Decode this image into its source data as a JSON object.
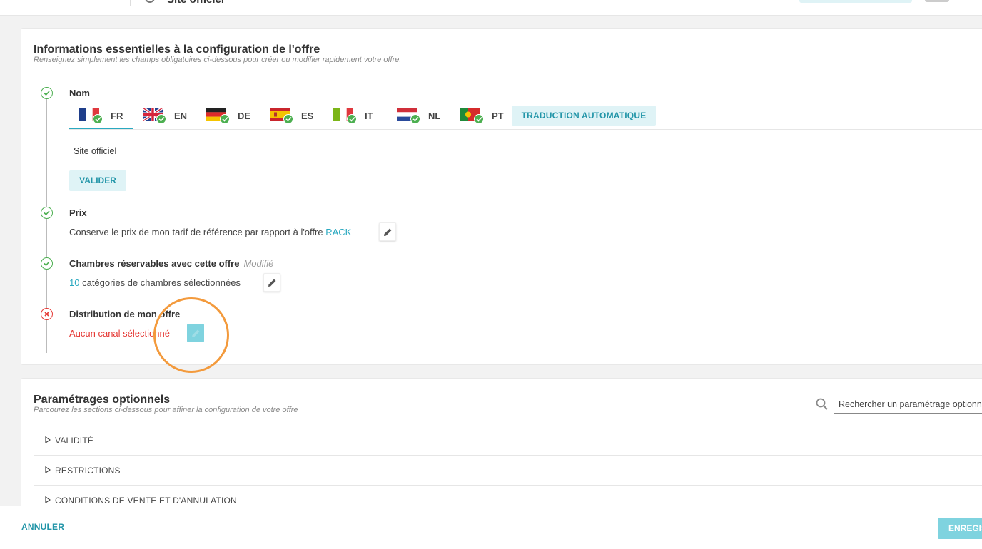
{
  "header": {
    "title": "Site officiel"
  },
  "essentials": {
    "title": "Informations essentielles à la configuration de l'offre",
    "subtitle": "Renseignez simplement les champs obligatoires ci-dessous pour créer ou modifier rapidement votre offre.",
    "name": {
      "label": "Nom",
      "languages": [
        {
          "code": "FR",
          "active": true
        },
        {
          "code": "EN"
        },
        {
          "code": "DE"
        },
        {
          "code": "ES"
        },
        {
          "code": "IT"
        },
        {
          "code": "NL"
        },
        {
          "code": "PT"
        }
      ],
      "auto_translate_label": "TRADUCTION AUTOMATIQUE",
      "value": "Site officiel",
      "validate_label": "VALIDER"
    },
    "price": {
      "label": "Prix",
      "text": "Conserve le prix de mon tarif de référence par rapport à l'offre",
      "reference": "RACK"
    },
    "rooms": {
      "label": "Chambres réservables avec cette offre",
      "modified": "Modifié",
      "count": "10",
      "text": "catégories de chambres sélectionnées"
    },
    "distribution": {
      "label": "Distribution de mon offre",
      "text": "Aucun canal sélectionné"
    }
  },
  "optional": {
    "title": "Paramétrages optionnels",
    "subtitle": "Parcourez les sections ci-dessous pour affiner la configuration de votre offre",
    "search_placeholder": "Rechercher un paramétrage optionnel",
    "sections": [
      "VALIDITÉ",
      "RESTRICTIONS",
      "CONDITIONS DE VENTE ET D'ANNULATION"
    ]
  },
  "footer": {
    "cancel_label": "ANNULER",
    "save_label": "ENREGISTRER"
  },
  "colors": {
    "accent": "#2aa9c0",
    "success": "#4caf50",
    "error": "#e53935",
    "highlight": "#f39a3c"
  }
}
